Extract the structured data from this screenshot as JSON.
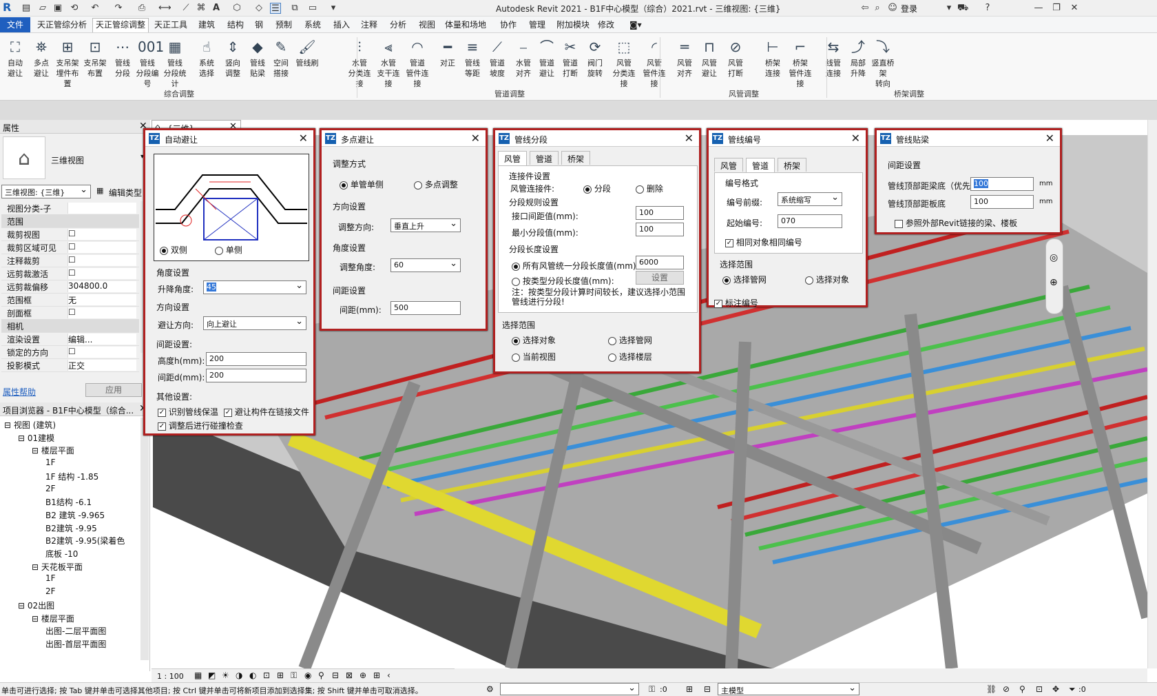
{
  "title": "Autodesk Revit 2021 - B1F中心模型（综合）2021.rvt - 三维视图: {三维}",
  "login": "登录",
  "menus": [
    "文件",
    "天正管综分析",
    "天正管综调整",
    "天正工具",
    "建筑",
    "结构",
    "钢",
    "预制",
    "系统",
    "插入",
    "注释",
    "分析",
    "视图",
    "体量和场地",
    "协作",
    "管理",
    "附加模块",
    "修改"
  ],
  "ribbon": {
    "tools": [
      {
        "l1": "自动",
        "l2": "避让",
        "icon": "⛶"
      },
      {
        "l1": "多点",
        "l2": "避让",
        "icon": "⛯"
      },
      {
        "l1": "支吊架",
        "l2": "埋件布置",
        "icon": "⊞"
      },
      {
        "l1": "支吊架",
        "l2": "布置",
        "icon": "⊡"
      },
      {
        "l1": "管线",
        "l2": "分段",
        "icon": "⋯"
      },
      {
        "l1": "管线",
        "l2": "分段编号",
        "icon": "001"
      },
      {
        "l1": "管线",
        "l2": "分段统计",
        "icon": "▦"
      },
      {
        "l1": "系统",
        "l2": "选择",
        "icon": "☝"
      },
      {
        "l1": "竖向",
        "l2": "调整",
        "icon": "⇕"
      },
      {
        "l1": "管线",
        "l2": "贴梁",
        "icon": "◆"
      },
      {
        "l1": "空间",
        "l2": "搭接",
        "icon": "✎"
      },
      {
        "l1": "管线刷",
        "l2": "",
        "icon": "🖌"
      },
      {
        "l1": "水管",
        "l2": "分类连接",
        "icon": "⫶"
      },
      {
        "l1": "水管",
        "l2": "支干连接",
        "icon": "⫷"
      },
      {
        "l1": "管道",
        "l2": "管件连接",
        "icon": "◠"
      },
      {
        "l1": "对正",
        "l2": "",
        "icon": "━"
      },
      {
        "l1": "管线",
        "l2": "等距",
        "icon": "≡"
      },
      {
        "l1": "管道",
        "l2": "坡度",
        "icon": "⟋"
      },
      {
        "l1": "水管",
        "l2": "对齐",
        "icon": "⎯"
      },
      {
        "l1": "管道",
        "l2": "避让",
        "icon": "⌒"
      },
      {
        "l1": "管道",
        "l2": "打断",
        "icon": "✂"
      },
      {
        "l1": "阀门",
        "l2": "旋转",
        "icon": "⟳"
      },
      {
        "l1": "风管",
        "l2": "分类连接",
        "icon": "⬚"
      },
      {
        "l1": "风管",
        "l2": "管件连接",
        "icon": "◜"
      },
      {
        "l1": "风管",
        "l2": "对齐",
        "icon": "═"
      },
      {
        "l1": "风管",
        "l2": "避让",
        "icon": "⊓"
      },
      {
        "l1": "风管",
        "l2": "打断",
        "icon": "⊘"
      },
      {
        "l1": "桥架",
        "l2": "连接",
        "icon": "⊢"
      },
      {
        "l1": "桥架",
        "l2": "管件连接",
        "icon": "⌐"
      },
      {
        "l1": "线管",
        "l2": "连接",
        "icon": "⇆"
      },
      {
        "l1": "局部",
        "l2": "升降",
        "icon": "⤴"
      },
      {
        "l1": "竖直桥架",
        "l2": "转向",
        "icon": "⤵"
      }
    ],
    "groups": [
      "综合调整",
      "管道调整",
      "风管调整",
      "桥架调整"
    ]
  },
  "properties": {
    "title": "属性",
    "type_name": "三维视图",
    "view_selector": "三维视图: {三维}",
    "edit_type": "编辑类型",
    "rows": [
      {
        "k": "视图分类-子",
        "v": ""
      },
      {
        "k": "范围",
        "v": "",
        "section": true
      },
      {
        "k": "裁剪视图",
        "v": "☐"
      },
      {
        "k": "裁剪区域可见",
        "v": "☐"
      },
      {
        "k": "注释裁剪",
        "v": "☐"
      },
      {
        "k": "远剪裁激活",
        "v": "☐"
      },
      {
        "k": "远剪裁偏移",
        "v": "304800.0"
      },
      {
        "k": "范围框",
        "v": "无"
      },
      {
        "k": "剖面框",
        "v": "☐"
      },
      {
        "k": "相机",
        "v": "",
        "section": true
      },
      {
        "k": "渲染设置",
        "v": "编辑..."
      },
      {
        "k": "锁定的方向",
        "v": "☐"
      },
      {
        "k": "投影模式",
        "v": "正交"
      }
    ],
    "help": "属性帮助",
    "apply": "应用"
  },
  "browser": {
    "title": "项目浏览器 - B1F中心模型（综合...",
    "nodes": [
      {
        "t": "视图 (建筑)",
        "lvl": 0
      },
      {
        "t": "01建模",
        "lvl": 1
      },
      {
        "t": "楼层平面",
        "lvl": 2
      },
      {
        "t": "1F",
        "lvl": 3
      },
      {
        "t": "1F 结构 -1.85",
        "lvl": 3
      },
      {
        "t": "2F",
        "lvl": 3
      },
      {
        "t": "B1结构 -6.1",
        "lvl": 3
      },
      {
        "t": "B2 建筑 -9.965",
        "lvl": 3
      },
      {
        "t": "B2建筑 -9.95",
        "lvl": 3
      },
      {
        "t": "B2建筑 -9.95(梁着色",
        "lvl": 3
      },
      {
        "t": "底板 -10",
        "lvl": 3
      },
      {
        "t": "天花板平面",
        "lvl": 2
      },
      {
        "t": "1F",
        "lvl": 3
      },
      {
        "t": "2F",
        "lvl": 3
      },
      {
        "t": "02出图",
        "lvl": 1
      },
      {
        "t": "楼层平面",
        "lvl": 2
      },
      {
        "t": "出图-二层平面图",
        "lvl": 3
      },
      {
        "t": "出图-首层平面图",
        "lvl": 3
      }
    ]
  },
  "view_tab": "{三维}",
  "dlg_auto": {
    "title": "自动避让",
    "both": "双侧",
    "single": "单侧",
    "angle_section": "角度设置",
    "angle_label": "升降角度:",
    "angle_value": "45",
    "dir_section": "方向设置",
    "dir_label": "避让方向:",
    "dir_value": "向上避让",
    "gap_section": "间距设置:",
    "h_label": "高度h(mm):",
    "h_value": "200",
    "d_label": "间距d(mm):",
    "d_value": "200",
    "other_section": "其他设置:",
    "opt1": "识别管线保温",
    "opt2": "避让构件在链接文件",
    "opt3": "调整后进行碰撞检查"
  },
  "dlg_multi": {
    "title": "多点避让",
    "mode_section": "调整方式",
    "single": "单管单侧",
    "multi": "多点调整",
    "dir_section": "方向设置",
    "dir_label": "调整方向:",
    "dir_value": "垂直上升",
    "angle_section": "角度设置",
    "angle_label": "调整角度:",
    "angle_value": "60",
    "gap_section": "间距设置",
    "gap_label": "间距(mm):",
    "gap_value": "500"
  },
  "dlg_seg": {
    "title": "管线分段",
    "tabs": [
      "风管",
      "管道",
      "桥架"
    ],
    "conn_section": "连接件设置",
    "conn_label": "风管连接件:",
    "seg": "分段",
    "del": "删除",
    "rule_section": "分段规则设置",
    "iface_label": "接口间距值(mm):",
    "iface_value": "100",
    "min_label": "最小分段值(mm):",
    "min_value": "100",
    "len_section": "分段长度设置",
    "all_label": "所有风管统一分段长度值(mm):",
    "all_value": "6000",
    "type_label": "按类型分段长度值(mm):",
    "set_btn": "设置",
    "note": "注：按类型分段计算时间较长，建议选择小范围管线进行分段!",
    "range_section": "选择范围",
    "r1": "选择对象",
    "r2": "选择管网",
    "r3": "当前视图",
    "r4": "选择楼层"
  },
  "dlg_num": {
    "title": "管线编号",
    "tabs": [
      "风管",
      "管道",
      "桥架"
    ],
    "fmt_section": "编号格式",
    "prefix_label": "编号前缀:",
    "prefix_value": "系统缩写",
    "start_label": "起始编号:",
    "start_value": "070",
    "same": "相同对象相同编号",
    "range_section": "选择范围",
    "r1": "选择管网",
    "r2": "选择对象",
    "mark": "标注编号"
  },
  "dlg_beam": {
    "title": "管线贴梁",
    "section": "间距设置",
    "l1": "管线顶部距梁底（优先）",
    "v1": "100",
    "l2": "管线顶部距板底",
    "v2": "100",
    "unit": "mm",
    "opt": "参照外部Revit链接的梁、楼板"
  },
  "viewctl": {
    "scale": "1 : 100"
  },
  "status": {
    "text": "单击可进行选择; 按 Tab 键并单击可选择其他项目; 按 Ctrl 键并单击可将新项目添加到选择集; 按 Shift 键并单击可取消选择。",
    "zero": ":0",
    "model": "主模型",
    "filter": ":0"
  },
  "colors": {
    "accent": "#1f5fbf",
    "dialog_border": "#b02020"
  }
}
